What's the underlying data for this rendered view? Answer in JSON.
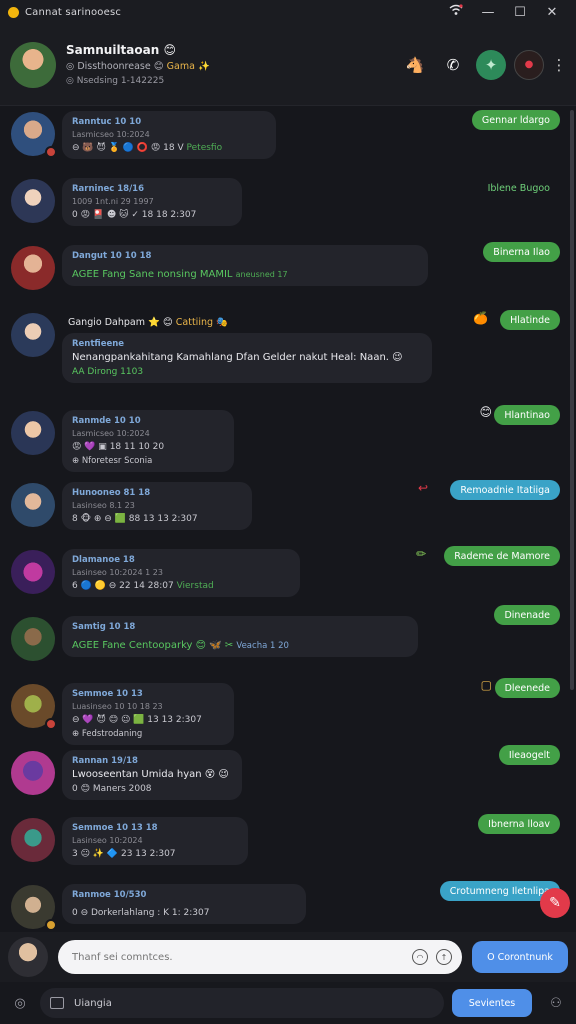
{
  "window": {
    "title": "Cannat sarinooesc",
    "signal_icon": "wifi-icon"
  },
  "header": {
    "name": "Samnuiltaoan",
    "subtitle": "Dissthoonrease",
    "subtitle_tag": "Gama",
    "status": "Nsedsing 1-142225",
    "actions": [
      "call-icon",
      "phone-icon",
      "status-icon",
      "profile-icon"
    ]
  },
  "messages": [
    {
      "name": "Ranntuc 10 10",
      "sub": "Lasmicseo 10:2024",
      "text": "",
      "meta": "18 V",
      "meta_extra": "Petesfio",
      "reply": "Gennar ldargo",
      "reply_style": "green"
    },
    {
      "name": "Rarninec 18/16",
      "sub": "1009 1nt.ni 29 1997",
      "text": "",
      "meta": "18 18 2:307",
      "meta_extra": "",
      "reply": "Iblene Bugoo",
      "reply_style": "green-text"
    },
    {
      "name": "Dangut 10 10 18",
      "sub": "",
      "text": "AGEE Fang Sane nonsing MAMIL",
      "meta_extra": "aneusned 17",
      "reply": "Binerna Ilao",
      "reply_style": "green"
    },
    {
      "name": "Gangio Dahpam",
      "sub": "Rentfieene",
      "text": "Nenangpankahitang Kamahlang Dfan Gelder nakut Heal: Naan.",
      "meta": "AA Dirong 1103",
      "title_tag": "Cattiing",
      "reply": "Hlatinde",
      "reply_style": "green"
    },
    {
      "name": "Ranmde 10 10",
      "sub": "Lasmicseo 10:2024",
      "text": "",
      "meta": "18 11 10 20",
      "meta_extra": "Nforetesr Sconia",
      "reply": "Hlantinao",
      "reply_style": "green"
    },
    {
      "name": "Hunooneo 81 18",
      "sub": "Lasinseo 8.1 23",
      "text": "",
      "meta": "88 13 13 2:307",
      "meta_extra": "",
      "reply": "Remoadnie Itatiiga",
      "reply_style": "blue"
    },
    {
      "name": "Dlamanoe 18",
      "sub": "Lasinseo 10:2024 1 23",
      "text": "",
      "meta": "22 14 28:07",
      "meta_extra": "Vierstad",
      "reply": "Rademe de Mamore",
      "reply_style": "green"
    },
    {
      "name": "Samtig 10 18",
      "sub": "",
      "text": "AGEE Fane Centooparky",
      "meta_extra": "Veacha 1 20",
      "reply": "Dinenade",
      "reply_style": "green"
    },
    {
      "name": "Semmoe 10 13",
      "sub": "Luasinseo 10 10 18 23",
      "text": "",
      "meta": "13 13 2:307",
      "meta_extra": "Fedstrodaning",
      "reply": "Dleenede",
      "reply_style": "green"
    },
    {
      "name": "Rannan 19/18",
      "sub": "Lasmicseo 10:2024",
      "text": "Lwooseentan Umida hyan",
      "meta": "Maners 2008",
      "meta_extra": "",
      "reply": "Ileaogelt",
      "reply_style": "green"
    },
    {
      "name": "Semmoe 10 13 18",
      "sub": "Lasinseo 10:2024",
      "text": "",
      "meta": "23 13 2:307",
      "meta_extra": "",
      "reply": "Ibnerna lloav",
      "reply_style": "green"
    },
    {
      "name": "Ranmoe 10/530",
      "sub": "",
      "text": "",
      "meta": "Dorkerlahlang : K 1: 2:307",
      "meta_extra": "",
      "reply": "Crotumneng Iletnlipa",
      "reply_style": "blue"
    }
  ],
  "composer": {
    "placeholder": "Thanf sei comntces.",
    "send_label": "O Corontnunk"
  },
  "bottom_bar": {
    "field_label": "Uiangia",
    "send_label": "Sevientes"
  },
  "colors": {
    "accent_green": "#43a047",
    "accent_blue": "#3aa3c7",
    "send_blue": "#4f8fe8",
    "fab_red": "#e23a4a",
    "bg": "#16171c"
  }
}
